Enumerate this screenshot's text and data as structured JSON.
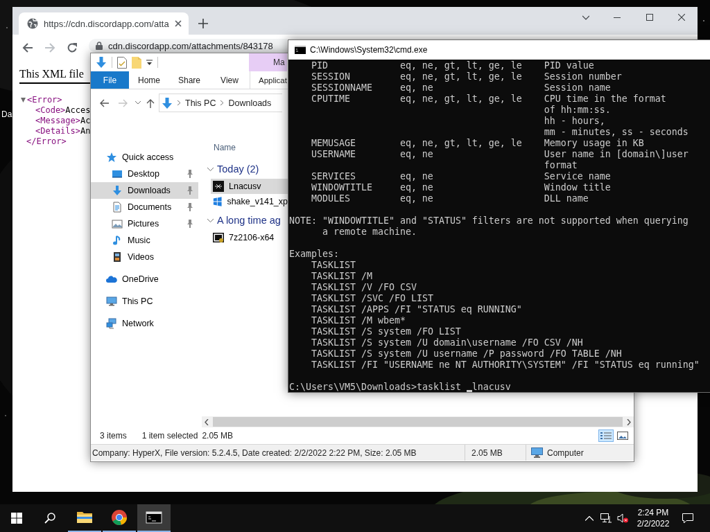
{
  "desktop": {
    "icon_label": "Da"
  },
  "browser": {
    "tab": {
      "title": "https://cdn.discordapp.com/atta",
      "selected": true
    },
    "address": "cdn.discordapp.com/attachments/843178",
    "page": {
      "heading": "This XML file",
      "xml": {
        "expanded": true,
        "open_tag": "<Error>",
        "children": [
          {
            "tag": "<Code>",
            "text": "Acces"
          },
          {
            "tag": "<Message>",
            "text": "Ac"
          },
          {
            "tag": "<Details>",
            "text": "An"
          }
        ],
        "close_tag": "</Error>"
      }
    }
  },
  "explorer": {
    "context_tab_group": "Ma",
    "ribbon_tabs": [
      {
        "label": "File",
        "kind": "file"
      },
      {
        "label": "Home",
        "kind": "tab"
      },
      {
        "label": "Share",
        "kind": "tab"
      },
      {
        "label": "View",
        "kind": "tab"
      },
      {
        "label": "Applicat",
        "kind": "context"
      }
    ],
    "address_path": [
      "This PC",
      "Downloads"
    ],
    "navigation": [
      {
        "label": "Quick access",
        "selected": false,
        "children": [
          {
            "label": "Desktop",
            "pinned": true,
            "selected": false
          },
          {
            "label": "Downloads",
            "pinned": true,
            "selected": true
          },
          {
            "label": "Documents",
            "pinned": true,
            "selected": false
          },
          {
            "label": "Pictures",
            "pinned": true,
            "selected": false
          },
          {
            "label": "Music",
            "pinned": false,
            "selected": false
          },
          {
            "label": "Videos",
            "pinned": false,
            "selected": false
          }
        ]
      },
      {
        "label": "OneDrive",
        "selected": false
      },
      {
        "label": "This PC",
        "selected": false
      },
      {
        "label": "Network",
        "selected": false
      }
    ],
    "column_header": "Name",
    "groups": [
      {
        "label": "Today (2)",
        "expanded": true,
        "files": [
          {
            "name": "Lnacusv",
            "selected": true
          },
          {
            "name": "shake_v141_xp",
            "selected": false
          }
        ]
      },
      {
        "label": "A long time ag",
        "expanded": true,
        "files": [
          {
            "name": "7z2106-x64",
            "selected": false
          }
        ]
      }
    ],
    "status": {
      "item_count": "3 items",
      "selection": "1 item selected",
      "selection_size": "2.05 MB",
      "views": [
        {
          "selected": true
        },
        {
          "selected": false
        }
      ]
    },
    "details_bar": {
      "details": "Company: HyperX, File version: 5.2.4.5, Date created: 2/2/2022 2:22 PM, Size: 2.05 MB",
      "size": "2.05 MB",
      "location": "Computer"
    }
  },
  "cmd": {
    "title": "C:\\Windows\\System32\\cmd.exe",
    "filters": [
      {
        "name": "PID",
        "operators": "eq, ne, gt, lt, ge, le",
        "description": [
          "PID value"
        ]
      },
      {
        "name": "SESSION",
        "operators": "eq, ne, gt, lt, ge, le",
        "description": [
          "Session number"
        ]
      },
      {
        "name": "SESSIONNAME",
        "operators": "eq, ne",
        "description": [
          "Session name"
        ]
      },
      {
        "name": "CPUTIME",
        "operators": "eq, ne, gt, lt, ge, le",
        "description": [
          "CPU time in the format",
          "of hh:mm:ss.",
          "hh - hours,",
          "mm - minutes, ss - seconds"
        ]
      },
      {
        "name": "MEMUSAGE",
        "operators": "eq, ne, gt, lt, ge, le",
        "description": [
          "Memory usage in KB"
        ]
      },
      {
        "name": "USERNAME",
        "operators": "eq, ne",
        "description": [
          "User name in [domain\\]user",
          "format"
        ]
      },
      {
        "name": "SERVICES",
        "operators": "eq, ne",
        "description": [
          "Service name"
        ]
      },
      {
        "name": "WINDOWTITLE",
        "operators": "eq, ne",
        "description": [
          "Window title"
        ]
      },
      {
        "name": "MODULES",
        "operators": "eq, ne",
        "description": [
          "DLL name"
        ]
      }
    ],
    "note": [
      "NOTE: \"WINDOWTITLE\" and \"STATUS\" filters are not supported when querying",
      "a remote machine."
    ],
    "examples_heading": "Examples:",
    "examples": [
      "TASKLIST",
      "TASKLIST /M",
      "TASKLIST /V /FO CSV",
      "TASKLIST /SVC /FO LIST",
      "TASKLIST /APPS /FI \"STATUS eq RUNNING\"",
      "TASKLIST /M wbem*",
      "TASKLIST /S system /FO LIST",
      "TASKLIST /S system /U domain\\username /FO CSV /NH",
      "TASKLIST /S system /U username /P password /FO TABLE /NH",
      "TASKLIST /FI \"USERNAME ne NT AUTHORITY\\SYSTEM\" /FI \"STATUS eq running\""
    ],
    "prompt": "C:\\Users\\VM5\\Downloads>tasklist",
    "text_after_cursor": "lnacusv"
  },
  "taskbar": {
    "apps": [
      {
        "running": true,
        "selected": false
      },
      {
        "running": true,
        "selected": false
      },
      {
        "running": true,
        "selected": true
      }
    ],
    "volume_muted": true,
    "time": "2:24 PM",
    "date": "2/2/2022"
  }
}
